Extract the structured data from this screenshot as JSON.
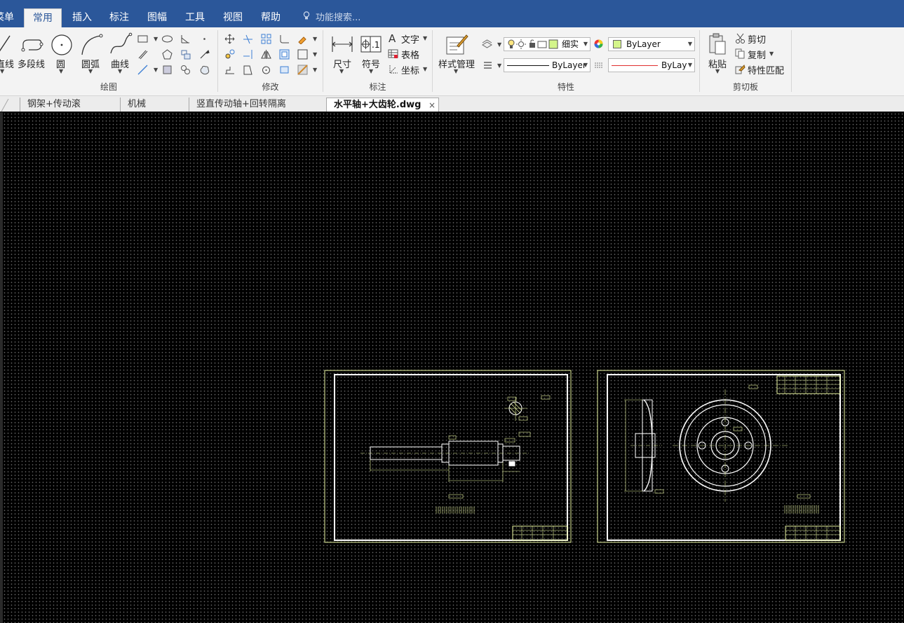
{
  "colors": {
    "menubar": "#2b579a",
    "ribbon": "#f3f3f3",
    "canvas": "#000000",
    "drawing_border": "#e8f5a0",
    "drawing_lines": "#ffffff",
    "bylayer_swatch": "#d4f58a",
    "linetype_red": "#e03030"
  },
  "menubar": {
    "items": [
      {
        "label": "菜单"
      },
      {
        "label": "常用",
        "active": true
      },
      {
        "label": "插入"
      },
      {
        "label": "标注"
      },
      {
        "label": "图幅"
      },
      {
        "label": "工具"
      },
      {
        "label": "视图"
      },
      {
        "label": "帮助"
      }
    ],
    "search_placeholder": "功能搜索..."
  },
  "ribbon": {
    "draw": {
      "label": "绘图",
      "line": "直线",
      "polyline": "多段线",
      "circle": "圆",
      "arc": "圆弧",
      "curve": "曲线"
    },
    "modify": {
      "label": "修改"
    },
    "annotate": {
      "label": "标注",
      "dimension": "尺寸",
      "symbol": "符号",
      "text": "文字",
      "table": "表格",
      "coordinate": "坐标"
    },
    "properties": {
      "label": "特性",
      "style_manager": "样式管理",
      "layer_value": "细实",
      "color_value": "ByLayer",
      "linetype_value": "ByLayer",
      "lineweight_value": "ByLay"
    },
    "clipboard": {
      "label": "剪切板",
      "paste": "粘贴",
      "cut": "剪切",
      "copy": "复制",
      "match": "特性匹配"
    }
  },
  "tabs": [
    {
      "label": "钢架+传动滚筒.dwg"
    },
    {
      "label": "机械手.dwg"
    },
    {
      "label": "竖直传动轴+回转隔离器.dwg"
    },
    {
      "label": "水平轴+大齿轮.dwg",
      "active": true
    }
  ]
}
